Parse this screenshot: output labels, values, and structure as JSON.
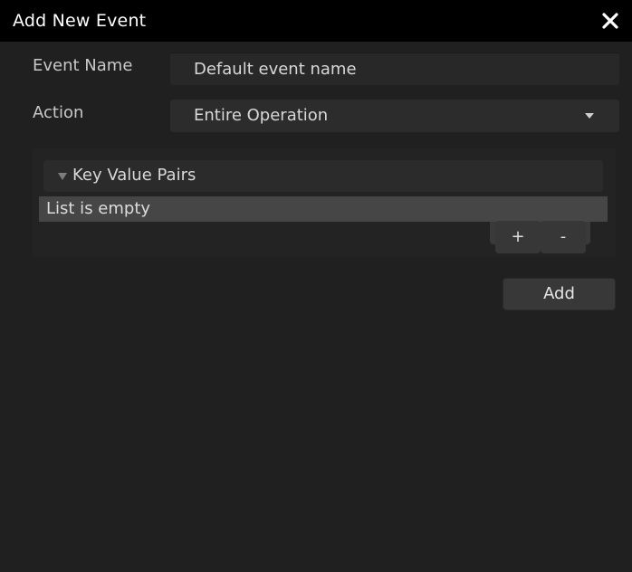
{
  "window": {
    "title": "Add New Event"
  },
  "form": {
    "event_name_label": "Event Name",
    "event_name_value": "Default event name",
    "action_label": "Action",
    "action_selected": "Entire Operation"
  },
  "key_value_pairs": {
    "header": "Key Value Pairs",
    "empty_text": "List is empty",
    "add_label": "+",
    "remove_label": "-"
  },
  "footer": {
    "add_label": "Add"
  },
  "colors": {
    "titlebar": "#000000",
    "background": "#202020",
    "field": "#282828",
    "list_row": "#464646",
    "button": "#383838"
  },
  "icons": {
    "close": "close-icon",
    "dropdown": "chevron-down-icon",
    "foldout": "triangle-down-icon"
  }
}
